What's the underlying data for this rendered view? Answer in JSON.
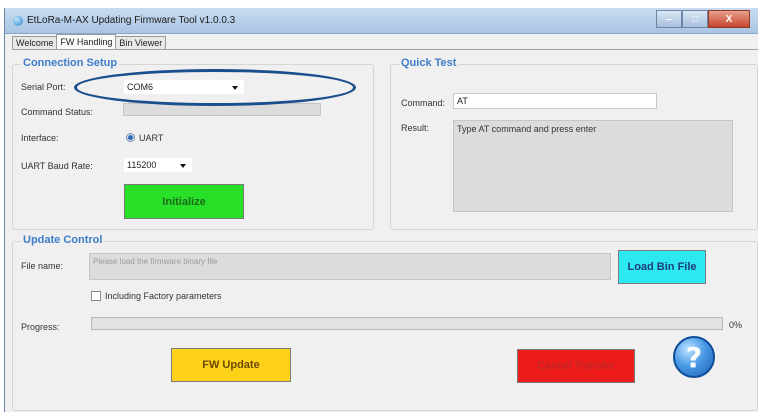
{
  "window": {
    "title": "EtLoRa-M-AX Updating Firmware Tool v1.0.0.3",
    "controls": {
      "minimize": "–",
      "maximize": "□",
      "close": "X"
    }
  },
  "tabs": [
    {
      "label": "Welcome"
    },
    {
      "label": "FW Handling"
    },
    {
      "label": "Bin Viewer"
    }
  ],
  "connection_setup": {
    "title": "Connection Setup",
    "serial_port_label": "Serial Port:",
    "serial_port_value": "COM6",
    "command_status_label": "Command Status:",
    "interface_label": "Interface:",
    "interface_value": "UART",
    "baud_label": "UART Baud Rate:",
    "baud_value": "115200",
    "initialize_label": "Initialize"
  },
  "quick_test": {
    "title": "Quick Test",
    "command_label": "Command:",
    "command_value": "AT",
    "result_label": "Result:",
    "result_value": "Type AT command and press enter"
  },
  "update_control": {
    "title": "Update Control",
    "file_name_label": "File name:",
    "file_name_placeholder": "Please load the firmware binary file",
    "load_bin_label": "Load Bin File",
    "factory_label": "Including Factory parameters",
    "progress_label": "Progress:",
    "progress_value": "0%",
    "fw_update_label": "FW Update",
    "cancel_label": "Cancel Transfer"
  },
  "help": {
    "glyph": "?"
  },
  "colors": {
    "group_title": "#3d7cc9",
    "initialize_bg": "#29e029",
    "load_bin_bg": "#2de8f0",
    "fw_update_bg": "#ffd21a",
    "cancel_bg": "#ee1b1b",
    "annotation": "#1a4e8c"
  }
}
